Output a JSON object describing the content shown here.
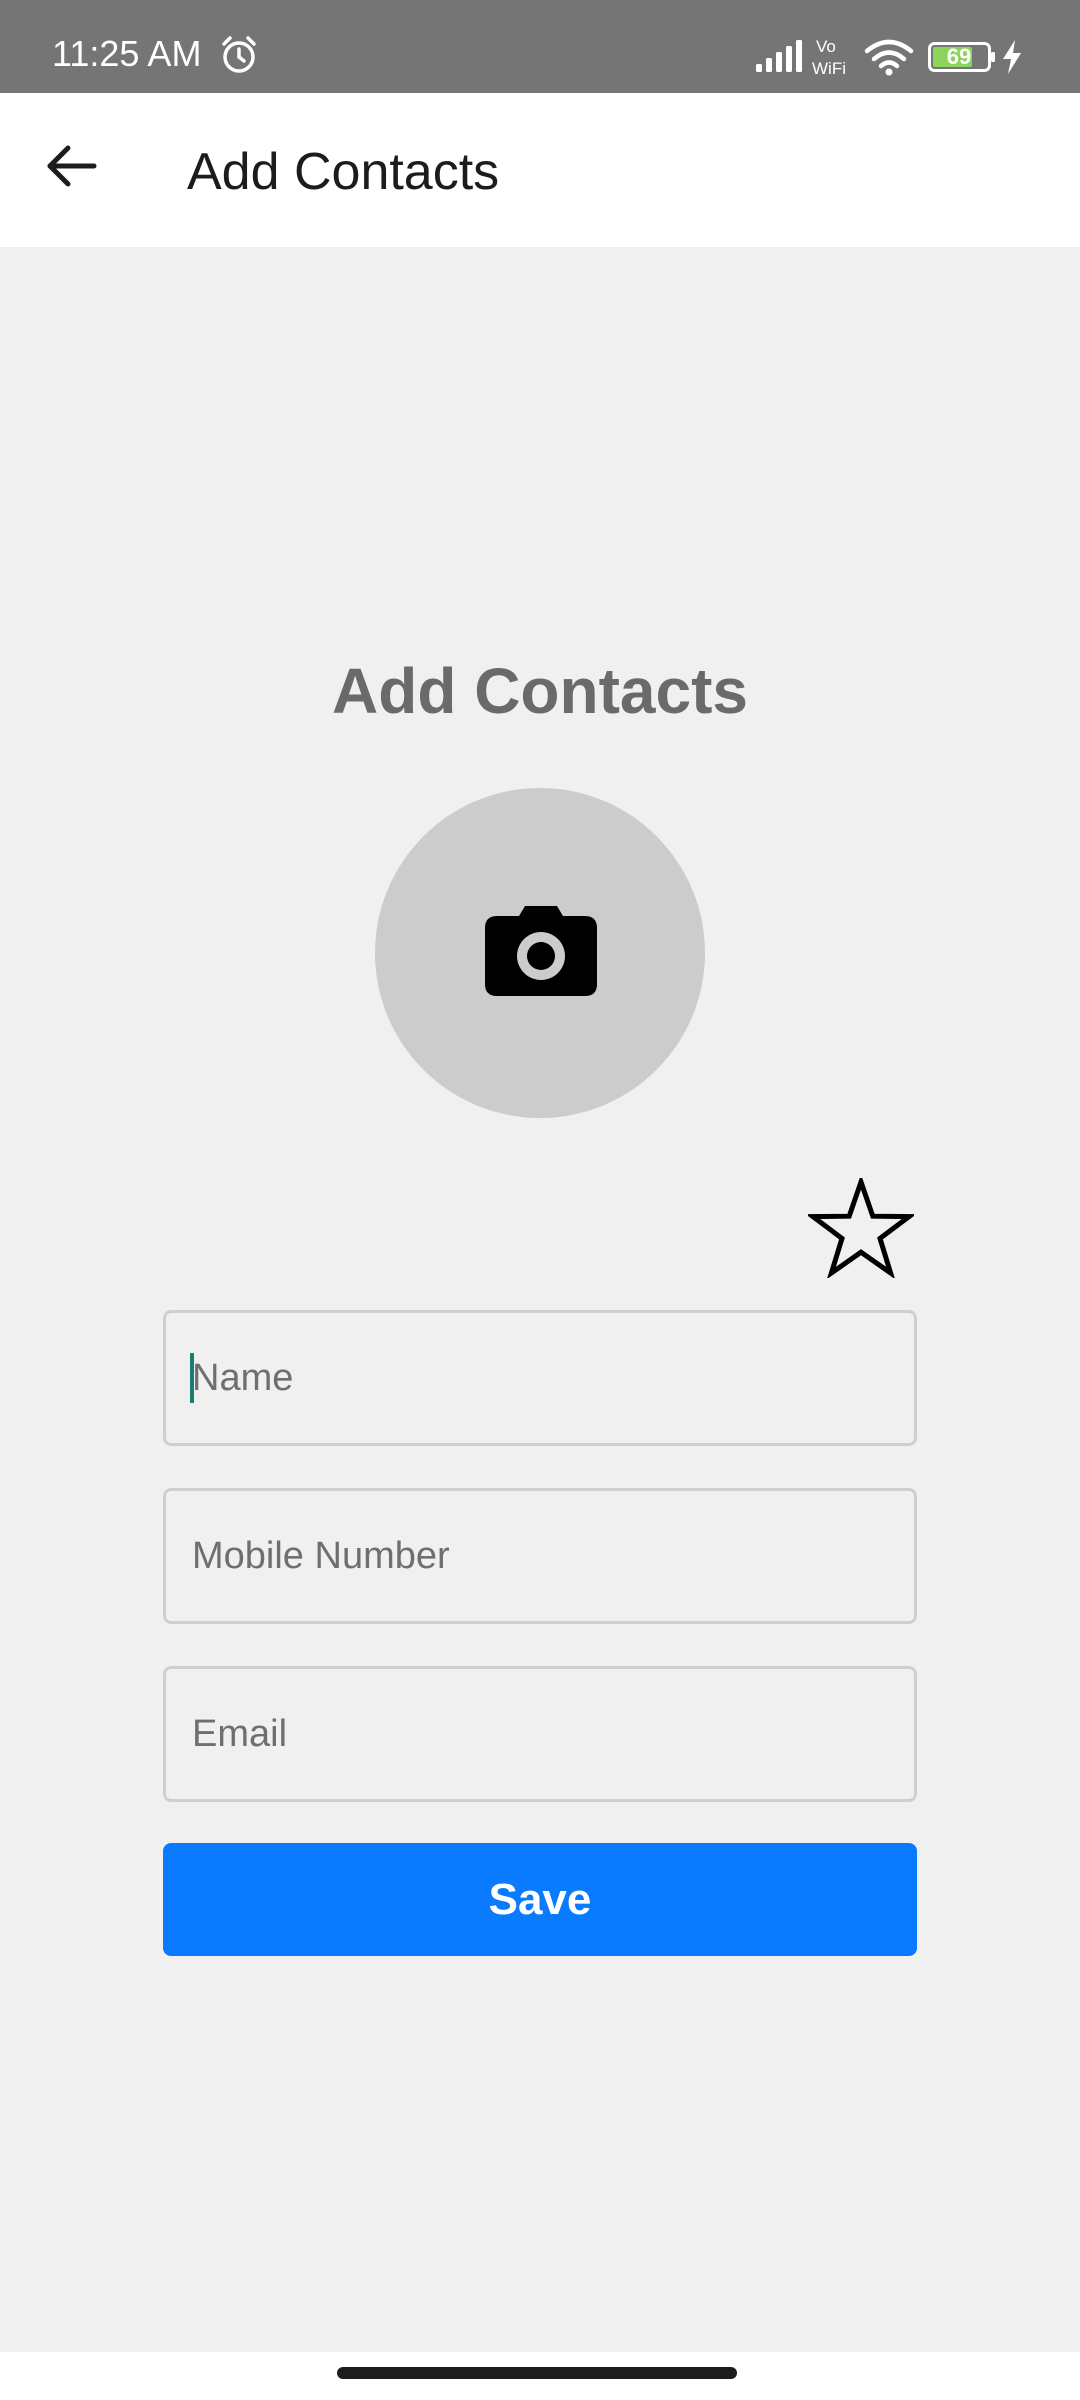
{
  "status_bar": {
    "time": "11:25 AM",
    "battery_level": "69",
    "icons": [
      "alarm-icon",
      "signal-icon",
      "vowifi-icon",
      "wifi-icon",
      "battery-icon",
      "charging-icon"
    ]
  },
  "app_bar": {
    "title": "Add Contacts",
    "back_icon": "arrow-left-icon"
  },
  "main": {
    "heading": "Add Contacts",
    "photo_icon": "camera-icon",
    "favorite_icon": "star-outline-icon",
    "fields": {
      "name": {
        "placeholder": "Name",
        "value": ""
      },
      "mobile": {
        "placeholder": "Mobile Number",
        "value": ""
      },
      "email": {
        "placeholder": "Email",
        "value": ""
      }
    },
    "save_label": "Save"
  },
  "colors": {
    "status_bar": "#757575",
    "accent": "#0a7bff",
    "background": "#f0f0f0",
    "photo_circle": "#cccccc",
    "heading": "#6a6a6a",
    "caret": "#16806e",
    "battery_fill": "#8bd45b"
  }
}
